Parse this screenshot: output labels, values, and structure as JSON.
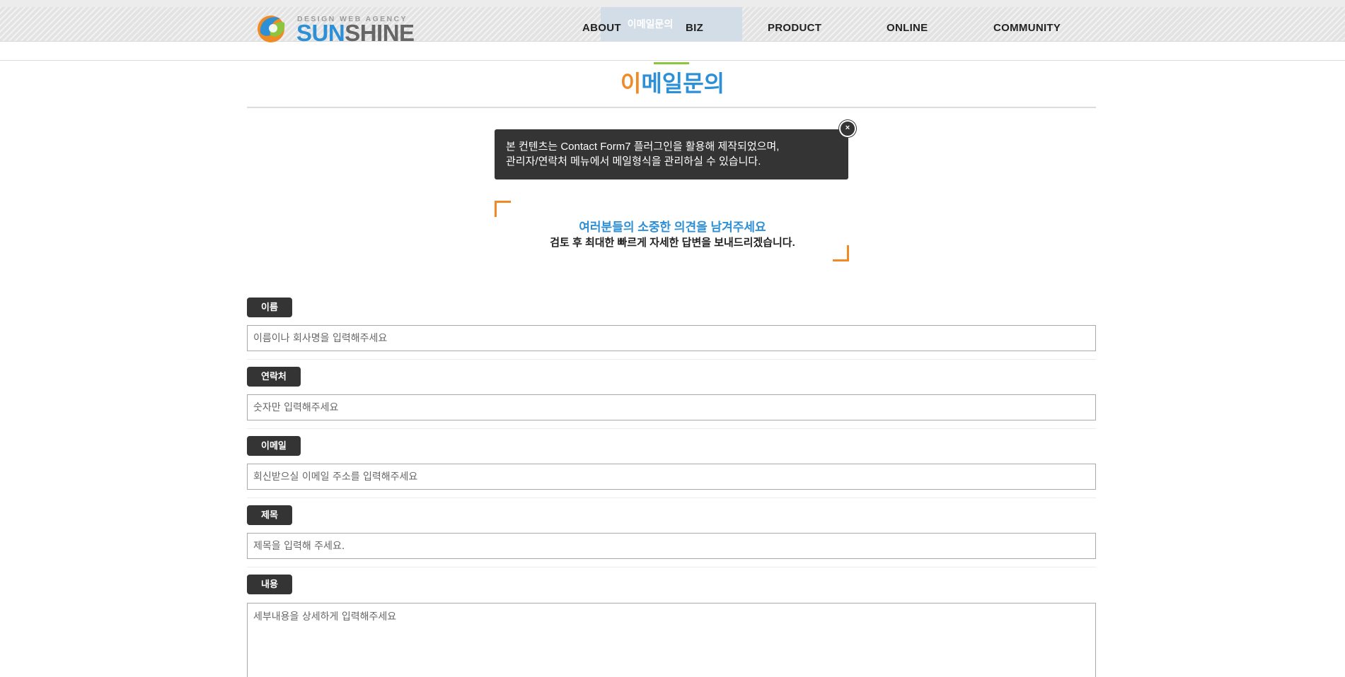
{
  "header": {
    "logo": {
      "tagline": "DESIGN WEB AGENCY",
      "word_part1": "SUN",
      "word_part2": "SHINE"
    },
    "active_highlight_label": "이메일문의",
    "nav": [
      {
        "label": "ABOUT"
      },
      {
        "label": "BIZ"
      },
      {
        "label": "PRODUCT"
      },
      {
        "label": "ONLINE"
      },
      {
        "label": "COMMUNITY"
      }
    ]
  },
  "page": {
    "title_first": "이",
    "title_rest": "메일문의"
  },
  "notice": {
    "line1": "본 컨텐츠는 Contact Form7 플러그인을 활용해 제작되었으며,",
    "line2": "관리자/연락처 메뉴에서 메일형식을 관리하실 수 있습니다.",
    "close_label": "×"
  },
  "intro": {
    "heading": "여러분들의 소중한 의견을 남겨주세요",
    "subheading": "검토 후 최대한 빠르게 자세한 답변을 보내드리겠습니다."
  },
  "form": {
    "name": {
      "label": "이름",
      "placeholder": "이름이나 회사명을 입력해주세요",
      "value": ""
    },
    "contact": {
      "label": "연락처",
      "placeholder": "숫자만 입력해주세요",
      "value": ""
    },
    "email": {
      "label": "이메일",
      "placeholder": "회신받으실 이메일 주소를 입력해주세요",
      "value": ""
    },
    "subject": {
      "label": "제목",
      "placeholder": "제목을 입력해 주세요.",
      "value": ""
    },
    "message": {
      "label": "내용",
      "placeholder": "세부내용을 상세하게 입력해주세요",
      "value": ""
    }
  },
  "colors": {
    "accent_orange": "#f08a24",
    "accent_blue": "#2d8fd6",
    "accent_green": "#8cc63f",
    "dark": "#343434"
  }
}
